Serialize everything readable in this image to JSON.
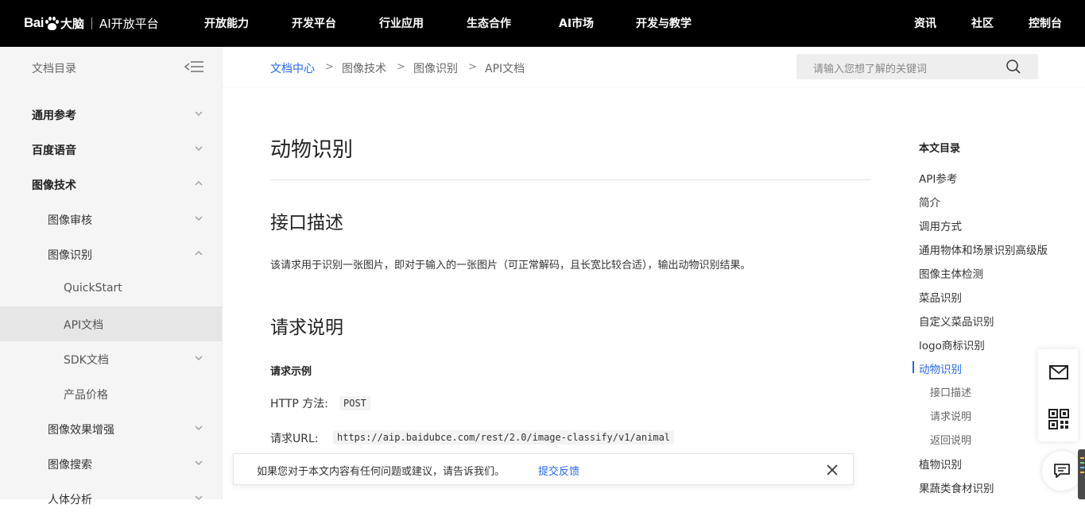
{
  "brand": {
    "logo_text": "Bai",
    "logo_suffix": "大脑",
    "platform": "AI开放平台"
  },
  "topnav": {
    "items": [
      "开放能力",
      "开发平台",
      "行业应用",
      "生态合作",
      "AI市场",
      "开发与教学"
    ],
    "right": [
      "资讯",
      "社区",
      "控制台"
    ]
  },
  "sidebar": {
    "title": "文档目录",
    "items": [
      {
        "label": "通用参考",
        "level": 1,
        "chevron": "down"
      },
      {
        "label": "百度语音",
        "level": 1,
        "chevron": "down"
      },
      {
        "label": "图像技术",
        "level": 1,
        "chevron": "up"
      },
      {
        "label": "图像审核",
        "level": 2,
        "chevron": "down"
      },
      {
        "label": "图像识别",
        "level": 2,
        "chevron": "up"
      },
      {
        "label": "QuickStart",
        "level": 3,
        "chevron": ""
      },
      {
        "label": "API文档",
        "level": 3,
        "chevron": "",
        "active": true
      },
      {
        "label": "SDK文档",
        "level": 3,
        "chevron": "down"
      },
      {
        "label": "产品价格",
        "level": 3,
        "chevron": ""
      },
      {
        "label": "图像效果增强",
        "level": 2,
        "chevron": "down"
      },
      {
        "label": "图像搜索",
        "level": 2,
        "chevron": "down"
      },
      {
        "label": "人体分析",
        "level": 2,
        "chevron": "down"
      }
    ]
  },
  "breadcrumb": [
    "文档中心",
    "图像技术",
    "图像识别",
    "API文档"
  ],
  "search": {
    "placeholder": "请输入您想了解的关键词"
  },
  "content": {
    "title": "动物识别",
    "section1": "接口描述",
    "description": "该请求用于识别一张图片，即对于输入的一张图片（可正常解码，且长宽比较合适），输出动物识别结果。",
    "section2": "请求说明",
    "example_heading": "请求示例",
    "method_label": "HTTP 方法:",
    "method_value": "POST",
    "url_label": "请求URL:",
    "url_value": "https://aip.baidubce.com/rest/2.0/image-classify/v1/animal"
  },
  "toc": {
    "title": "本文目录",
    "items": [
      {
        "label": "API参考",
        "sub": false
      },
      {
        "label": "简介",
        "sub": false
      },
      {
        "label": "调用方式",
        "sub": false
      },
      {
        "label": "通用物体和场景识别高级版",
        "sub": false
      },
      {
        "label": "图像主体检测",
        "sub": false
      },
      {
        "label": "菜品识别",
        "sub": false
      },
      {
        "label": "自定义菜品识别",
        "sub": false
      },
      {
        "label": "logo商标识别",
        "sub": false
      },
      {
        "label": "动物识别",
        "sub": false,
        "active": true
      },
      {
        "label": "接口描述",
        "sub": true
      },
      {
        "label": "请求说明",
        "sub": true
      },
      {
        "label": "返回说明",
        "sub": true
      },
      {
        "label": "植物识别",
        "sub": false
      },
      {
        "label": "果蔬类食材识别",
        "sub": false
      }
    ]
  },
  "feedback": {
    "message": "如果您对于本文内容有任何问题或建议，请告诉我们。",
    "link": "提交反馈"
  },
  "colors": {
    "accent": "#2468f2",
    "nav_bg": "#000000",
    "sidebar_bg": "#f5f5f5"
  },
  "icons": {
    "sidebar_toggle": "collapse-menu-icon",
    "search": "search-icon",
    "mail": "mail-icon",
    "qr": "qr-code-icon",
    "chat": "chat-icon",
    "close": "close-icon"
  }
}
